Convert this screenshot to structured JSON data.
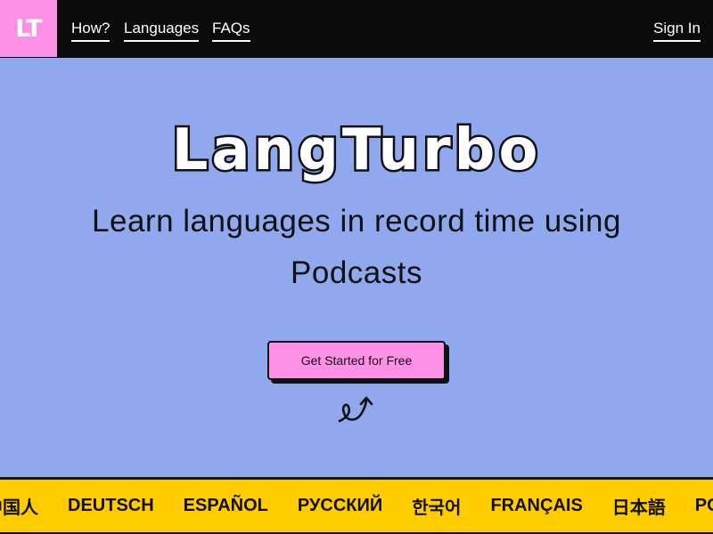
{
  "nav": {
    "logo": "LT",
    "links": [
      "How?",
      "Languages",
      "FAQs"
    ],
    "sign_in": "Sign In"
  },
  "hero": {
    "title": "LangTurbo",
    "subtitle": "Learn languages in record time using Podcasts",
    "cta": "Get Started for Free"
  },
  "ticker": {
    "languages": [
      "中国人",
      "DEUTSCH",
      "ESPAÑOL",
      "РУССКИЙ",
      "한국어",
      "FRANÇAIS",
      "日本語",
      "PORTUGUÊS"
    ]
  },
  "colors": {
    "accent_pink": "#ff90e8",
    "background": "#8fa8ee",
    "ticker": "#ffcc00",
    "nav": "#0b0b0b"
  }
}
